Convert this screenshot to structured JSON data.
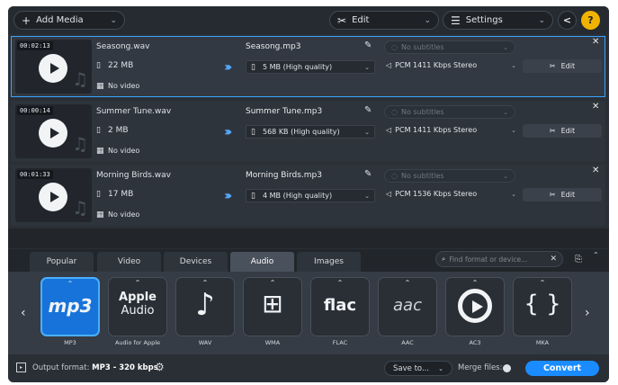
{
  "toolbar": {
    "add_media_label": "Add Media",
    "edit_label": "Edit",
    "settings_label": "Settings",
    "help_label": "?"
  },
  "files": [
    {
      "duration": "00:02:13",
      "src_name": "Seasong.wav",
      "src_size": "22 MB",
      "src_video": "No video",
      "out_name": "Seasong.mp3",
      "out_quality": "5 MB (High quality)",
      "subtitles": "No subtitles",
      "audio": "PCM 1411 Kbps Stereo",
      "edit_label": "Edit",
      "selected": true
    },
    {
      "duration": "00:00:14",
      "src_name": "Summer Tune.wav",
      "src_size": "2 MB",
      "src_video": "No video",
      "out_name": "Summer Tune.mp3",
      "out_quality": "568 KB (High quality)",
      "subtitles": "No subtitles",
      "audio": "PCM 1411 Kbps Stereo",
      "edit_label": "Edit",
      "selected": false
    },
    {
      "duration": "00:01:33",
      "src_name": "Morning Birds.wav",
      "src_size": "17 MB",
      "src_video": "No video",
      "out_name": "Morning Birds.mp3",
      "out_quality": "4 MB (High quality)",
      "subtitles": "No subtitles",
      "audio": "PCM 1536 Kbps Stereo",
      "edit_label": "Edit",
      "selected": false
    }
  ],
  "tabs": [
    "Popular",
    "Video",
    "Devices",
    "Audio",
    "Images"
  ],
  "active_tab": "Audio",
  "search_placeholder": "Find format or device...",
  "formats": [
    {
      "label": "MP3",
      "glyph": "mp3",
      "active": true
    },
    {
      "label": "Audio for Apple",
      "glyph": "Apple Audio",
      "active": false
    },
    {
      "label": "WAV",
      "glyph": "♪",
      "active": false
    },
    {
      "label": "WMA",
      "glyph": "windows",
      "active": false
    },
    {
      "label": "FLAC",
      "glyph": "flac",
      "active": false
    },
    {
      "label": "AAC",
      "glyph": "aac",
      "active": false
    },
    {
      "label": "AC3",
      "glyph": "ac3",
      "active": false
    },
    {
      "label": "MKA",
      "glyph": "{ }",
      "active": false
    }
  ],
  "bottom": {
    "output_format_label": "Output format:",
    "output_format_value": "MP3 - 320 kbps",
    "save_to_label": "Save to...",
    "merge_label": "Merge files:",
    "convert_label": "Convert"
  },
  "colors": {
    "accent": "#1a8cff",
    "selected_border": "#3aa3ff",
    "active_format": "#1773d9"
  }
}
